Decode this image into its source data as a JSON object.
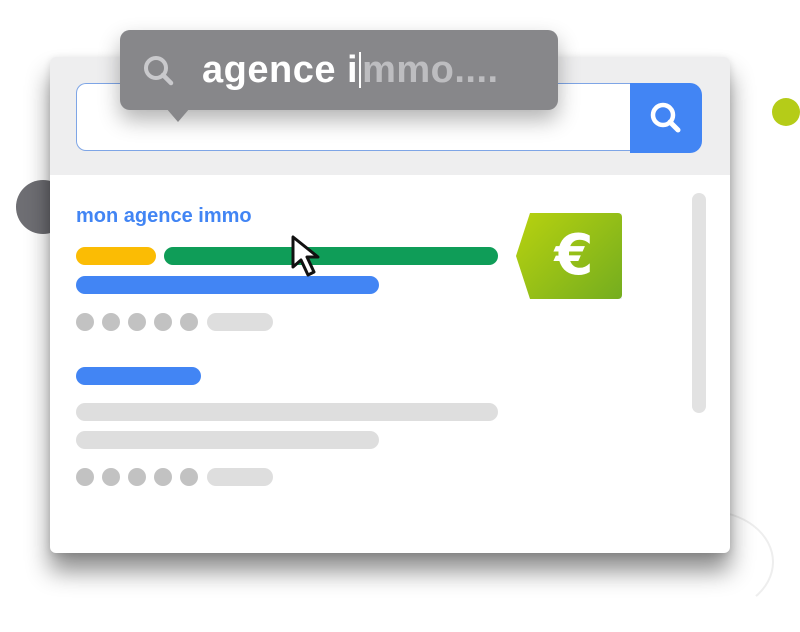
{
  "search": {
    "typed_text": "agence i",
    "suggestion_text": "mmo....",
    "button_icon": "search-icon"
  },
  "results": [
    {
      "title": "mon agence immo"
    }
  ],
  "price_tag": {
    "symbol": "€",
    "color": "#8dbf1a"
  },
  "colors": {
    "accent_blue": "#4285f4",
    "accent_green": "#0f9d58",
    "accent_yellow": "#fbbc04",
    "tooltip_bg": "#87878a"
  }
}
